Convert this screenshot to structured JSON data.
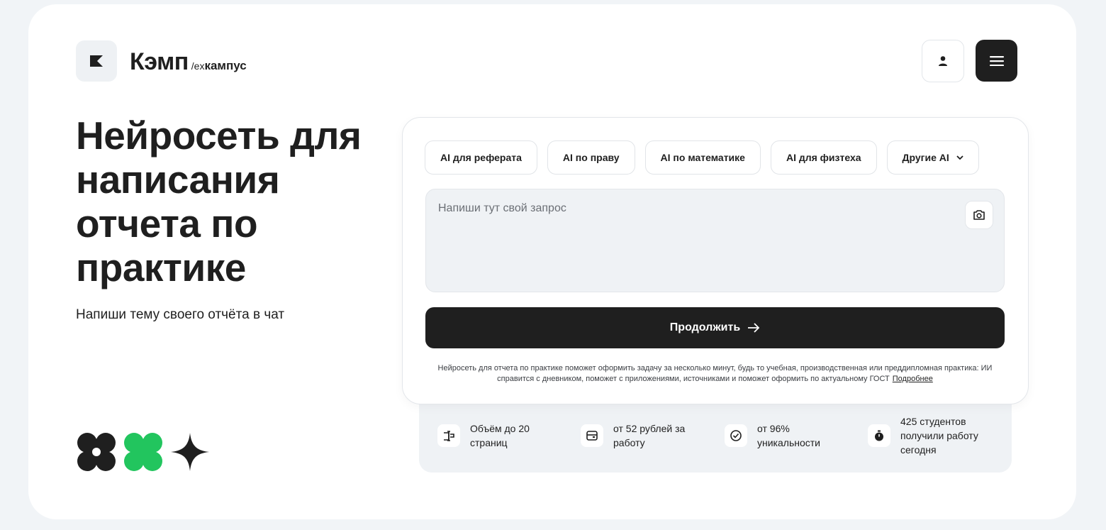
{
  "brand": {
    "name": "Кэмп",
    "ex_prefix": "/ex",
    "ex_name": "кампус"
  },
  "header": {
    "user_icon": "user-icon",
    "menu_icon": "menu-icon"
  },
  "hero": {
    "title": "Нейросеть для написания отчета по практике",
    "subtitle": "Напиши тему своего отчёта в чат"
  },
  "chips": [
    {
      "label": "AI для реферата"
    },
    {
      "label": "AI по праву"
    },
    {
      "label": "AI по математике"
    },
    {
      "label": "AI для физтеха"
    },
    {
      "label": "Другие AI"
    }
  ],
  "prompt": {
    "placeholder": "Напиши тут свой запрос",
    "value": ""
  },
  "continue_label": "Продолжить",
  "disclaimer": {
    "text": "Нейросеть для отчета по практике поможет оформить задачу за несколько минут, будь то учебная, производственная или преддипломная практика: ИИ справится с дневником, поможет с приложениями, источниками и поможет оформить по актуальному ГОСТ",
    "link": "Подробнее"
  },
  "stats": [
    {
      "text": "Объём до 20 страниц",
      "icon": "pages-icon"
    },
    {
      "text": "от 52 рублей за работу",
      "icon": "wallet-icon"
    },
    {
      "text": "от 96% уникальности",
      "icon": "check-circle-icon"
    },
    {
      "text": "425 студентов получили работу сегодня",
      "icon": "stopwatch-icon"
    }
  ],
  "colors": {
    "accent_green": "#22c55e",
    "dark": "#1f1f1f",
    "panel": "#eff2f5"
  }
}
